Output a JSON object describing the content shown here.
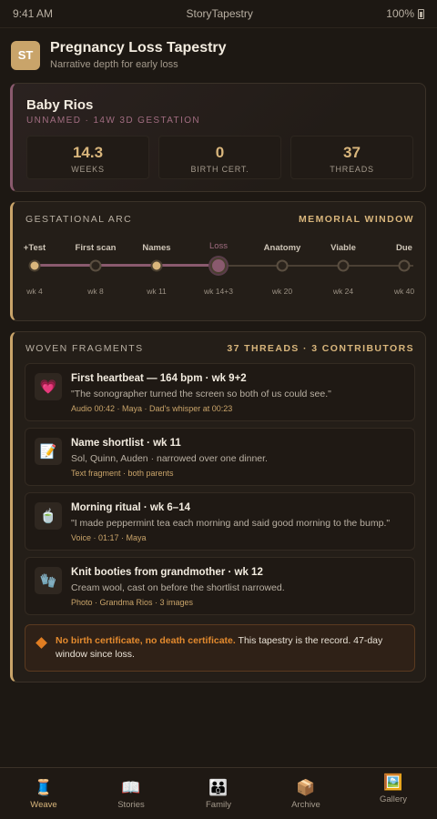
{
  "status": {
    "time": "9:41 AM",
    "app": "StoryTapestry",
    "battery": "100%"
  },
  "header": {
    "logo": "ST",
    "title": "Pregnancy Loss Tapestry",
    "subtitle": "Narrative depth for early loss"
  },
  "hero": {
    "name": "Baby Rios",
    "sub": "UNNAMED · 14W 3D GESTATION",
    "stats": [
      {
        "value": "14.3",
        "label": "WEEKS"
      },
      {
        "value": "0",
        "label": "BIRTH CERT."
      },
      {
        "value": "37",
        "label": "THREADS"
      }
    ]
  },
  "arc": {
    "title": "GESTATIONAL ARC",
    "action": "MEMORIAL WINDOW",
    "milestones": [
      {
        "label": "+Test",
        "week": "wk 4",
        "state": "done"
      },
      {
        "label": "First scan",
        "week": "wk 8",
        "state": "pending"
      },
      {
        "label": "Names",
        "week": "wk 11",
        "state": "done"
      },
      {
        "label": "Loss",
        "week": "wk 14+3",
        "state": "loss"
      },
      {
        "label": "Anatomy",
        "week": "wk 20",
        "state": "future"
      },
      {
        "label": "Viable",
        "week": "wk 24",
        "state": "future"
      },
      {
        "label": "Due",
        "week": "wk 40",
        "state": "future"
      }
    ]
  },
  "fragments": {
    "title": "WOVEN FRAGMENTS",
    "summary": "37 THREADS · 3 CONTRIBUTORS",
    "items": [
      {
        "icon": "💗",
        "icon_name": "heart-icon",
        "title": "First heartbeat — 164 bpm · wk 9+2",
        "quote": "\"The sonographer turned the screen so both of us could see.\"",
        "meta": "Audio 00:42 · Maya · Dad's whisper at 00:23"
      },
      {
        "icon": "📝",
        "icon_name": "memo-icon",
        "title": "Name shortlist · wk 11",
        "quote": "Sol, Quinn, Auden · narrowed over one dinner.",
        "meta": "Text fragment · both parents"
      },
      {
        "icon": "🍵",
        "icon_name": "tea-icon",
        "title": "Morning ritual · wk 6–14",
        "quote": "\"I made peppermint tea each morning and said good morning to the bump.\"",
        "meta": "Voice · 01:17 · Maya"
      },
      {
        "icon": "🧤",
        "icon_name": "glove-icon",
        "title": "Knit booties from grandmother · wk 12",
        "quote": "Cream wool, cast on before the shortlist narrowed.",
        "meta": "Photo · Grandma Rios · 3 images"
      }
    ],
    "notice": {
      "strong": "No birth certificate, no death certificate.",
      "text": " This tapestry is the record. 47-day window since loss."
    }
  },
  "tabs": [
    {
      "icon": "🧵",
      "icon_name": "thread-icon",
      "label": "Weave",
      "active": true
    },
    {
      "icon": "📖",
      "icon_name": "book-icon",
      "label": "Stories",
      "active": false
    },
    {
      "icon": "👪",
      "icon_name": "family-icon",
      "label": "Family",
      "active": false
    },
    {
      "icon": "📦",
      "icon_name": "box-icon",
      "label": "Archive",
      "active": false
    },
    {
      "icon": "🖼️",
      "icon_name": "picture-icon",
      "label": "Gallery",
      "active": false
    }
  ],
  "colors": {
    "accent": "#d9b67c",
    "loss": "#8a5a6e",
    "background": "#1d1813",
    "warning": "#e07d22"
  }
}
